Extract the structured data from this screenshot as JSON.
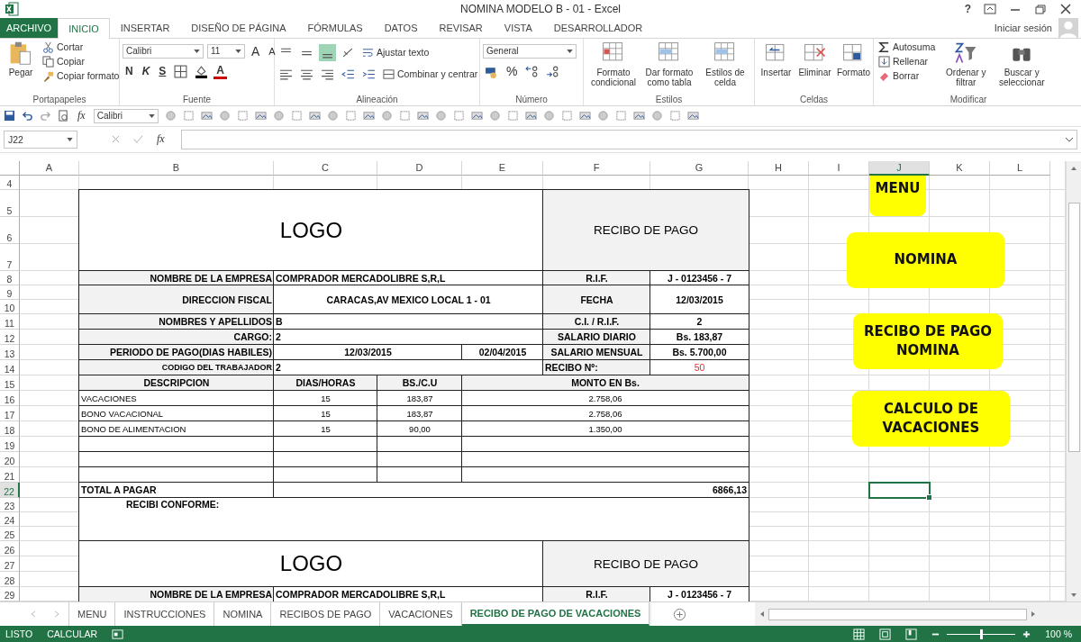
{
  "window": {
    "title": "NOMINA MODELO B - 01 - Excel",
    "help": "?",
    "account": "Iniciar sesión"
  },
  "ribbon_tabs": [
    {
      "label": "ARCHIVO",
      "kind": "file",
      "selected": false
    },
    {
      "label": "INICIO",
      "kind": "tab",
      "selected": true
    },
    {
      "label": "INSERTAR",
      "kind": "tab",
      "selected": false
    },
    {
      "label": "DISEÑO DE PÁGINA",
      "kind": "tab",
      "selected": false
    },
    {
      "label": "FÓRMULAS",
      "kind": "tab",
      "selected": false
    },
    {
      "label": "DATOS",
      "kind": "tab",
      "selected": false
    },
    {
      "label": "REVISAR",
      "kind": "tab",
      "selected": false
    },
    {
      "label": "VISTA",
      "kind": "tab",
      "selected": false
    },
    {
      "label": "DESARROLLADOR",
      "kind": "tab",
      "selected": false
    }
  ],
  "ribbon": {
    "clipboard": {
      "paste": "Pegar",
      "cut": "Cortar",
      "copy": "Copiar",
      "painter": "Copiar formato",
      "label": "Portapapeles"
    },
    "font": {
      "family": "Calibri",
      "size": "11",
      "grow": "A",
      "shrink": "A",
      "bold": "N",
      "italic": "K",
      "underline": "S",
      "font_color_letter": "A",
      "label": "Fuente"
    },
    "alignment": {
      "wrap": "Ajustar texto",
      "merge": "Combinar y centrar",
      "label": "Alineación"
    },
    "number": {
      "format": "General",
      "percent": "%",
      "label": "Número"
    },
    "styles": {
      "items": [
        "Formato condicional",
        "Dar formato como tabla",
        "Estilos de celda"
      ],
      "label": "Estilos"
    },
    "cells": {
      "items": [
        "Insertar",
        "Eliminar",
        "Formato"
      ],
      "label": "Celdas"
    },
    "editing": {
      "autosum": "Autosuma",
      "fill": "Rellenar",
      "clear": "Borrar",
      "sort": "Ordenar y filtrar",
      "find": "Buscar y seleccionar",
      "label": "Modificar"
    }
  },
  "quick_toolbar": {
    "fx": "fx",
    "font": "Calibri"
  },
  "formula_bar": {
    "cell": "J22",
    "fx": "fx"
  },
  "columns": [
    {
      "label": "A",
      "selected": false
    },
    {
      "label": "B",
      "selected": false
    },
    {
      "label": "C",
      "selected": false
    },
    {
      "label": "D",
      "selected": false
    },
    {
      "label": "E",
      "selected": false
    },
    {
      "label": "F",
      "selected": false
    },
    {
      "label": "G",
      "selected": false
    },
    {
      "label": "H",
      "selected": false
    },
    {
      "label": "I",
      "selected": false
    },
    {
      "label": "J",
      "selected": true
    },
    {
      "label": "K",
      "selected": false
    },
    {
      "label": "L",
      "selected": false
    }
  ],
  "rows": [
    {
      "label": "4",
      "selected": false
    },
    {
      "label": "5",
      "selected": false
    },
    {
      "label": "6",
      "selected": false
    },
    {
      "label": "7",
      "selected": false
    },
    {
      "label": "8",
      "selected": false
    },
    {
      "label": "9",
      "selected": false
    },
    {
      "label": "10",
      "selected": false
    },
    {
      "label": "11",
      "selected": false
    },
    {
      "label": "12",
      "selected": false
    },
    {
      "label": "13",
      "selected": false
    },
    {
      "label": "14",
      "selected": false
    },
    {
      "label": "15",
      "selected": false
    },
    {
      "label": "16",
      "selected": false
    },
    {
      "label": "17",
      "selected": false
    },
    {
      "label": "18",
      "selected": false
    },
    {
      "label": "19",
      "selected": false
    },
    {
      "label": "20",
      "selected": false
    },
    {
      "label": "21",
      "selected": false
    },
    {
      "label": "22",
      "selected": true
    },
    {
      "label": "23",
      "selected": false
    },
    {
      "label": "24",
      "selected": false
    },
    {
      "label": "25",
      "selected": false
    },
    {
      "label": "26",
      "selected": false
    },
    {
      "label": "27",
      "selected": false
    },
    {
      "label": "28",
      "selected": false
    },
    {
      "label": "29",
      "selected": false
    }
  ],
  "receipt": {
    "logo": "LOGO",
    "title": "RECIBO DE PAGO",
    "company_label": "NOMBRE DE LA EMPRESA",
    "company": "COMPRADOR MERCADOLIBRE S,R,L",
    "rif_label": "R.I.F.",
    "rif": "J - 0123456 - 7",
    "address_label": "DIRECCION FISCAL",
    "address": "CARACAS,AV MEXICO LOCAL 1 - 01",
    "date_label": "FECHA",
    "date": "12/03/2015",
    "name_label": "NOMBRES Y APELLIDOS",
    "name": "B",
    "id_label": "C.I. / R.I.F.",
    "id": "2",
    "job_label": "CARGO:",
    "job": "2",
    "daily_label": "SALARIO DIARIO",
    "daily": "Bs.  183,87",
    "period_label": "PERIODO DE PAGO(DIAS HABILES)",
    "period_start": "12/03/2015",
    "period_end": "02/04/2015",
    "monthly_label": "SALARIO MENSUAL",
    "monthly": "Bs.  5.700,00",
    "code_label": "CODIGO DEL TRABAJADOR",
    "code": "2",
    "number_label": "RECIBO Nº:",
    "number": "50",
    "columns": [
      "DESCRIPCION",
      "DIAS/HORAS",
      "BS./C.U",
      "MONTO EN Bs."
    ],
    "lines": [
      {
        "description": "VACACIONES",
        "days": "15",
        "unit": "183,87",
        "amount": "2.758,06"
      },
      {
        "description": "BONO VACACIONAL",
        "days": "15",
        "unit": "183,87",
        "amount": "2.758,06"
      },
      {
        "description": "BONO DE ALIMENTACION",
        "days": "15",
        "unit": "90,00",
        "amount": "1.350,00"
      }
    ],
    "total_label": "TOTAL A PAGAR",
    "total": "6866,13",
    "received": "RECIBI CONFORME:"
  },
  "receipt_2": {
    "logo": "LOGO",
    "title": "RECIBO DE PAGO",
    "company_label": "NOMBRE DE LA EMPRESA",
    "company": "COMPRADOR MERCADOLIBRE S,R,L",
    "rif_label": "R.I.F.",
    "rif": "J - 0123456 - 7"
  },
  "sheet_buttons": [
    "MENU",
    "NOMINA",
    "RECIBO DE PAGO NOMINA",
    "CALCULO DE VACACIONES"
  ],
  "sheet_tabs": [
    {
      "label": "MENU",
      "selected": false
    },
    {
      "label": "INSTRUCCIONES",
      "selected": false
    },
    {
      "label": "NOMINA",
      "selected": false
    },
    {
      "label": "RECIBOS DE PAGO",
      "selected": false
    },
    {
      "label": "VACACIONES",
      "selected": false
    },
    {
      "label": "RECIBO DE PAGO DE VACACIONES",
      "selected": true
    }
  ],
  "status_bar": {
    "state": "LISTO",
    "calc": "CALCULAR"
  },
  "zoom": {
    "level": 0.5,
    "reading": "100 %"
  }
}
